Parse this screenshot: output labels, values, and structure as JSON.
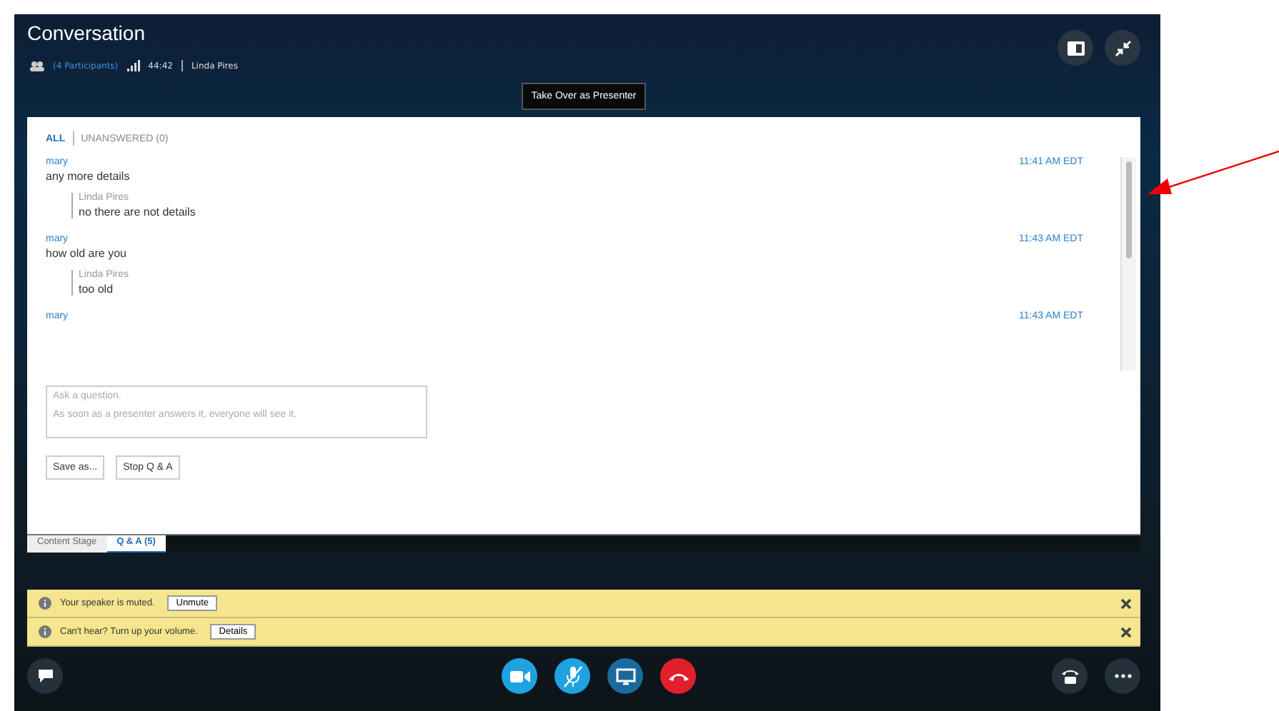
{
  "window": {
    "title": "Conversation"
  },
  "status": {
    "participants": "(4 Participants)",
    "duration": "44:42",
    "presenter": "Linda Pires"
  },
  "presenter_button": "Take Over as Presenter",
  "filters": [
    {
      "label": "ALL",
      "selected": true
    },
    {
      "label": "UNANSWERED (0)",
      "selected": false
    }
  ],
  "questions": [
    {
      "author": "mary",
      "text": "any more details",
      "time": "11:41 AM EDT",
      "answer": {
        "author": "Linda Pires",
        "text": "no there are not details"
      }
    },
    {
      "author": "mary",
      "text": "how old are you",
      "time": "11:43 AM EDT",
      "answer": {
        "author": "Linda Pires",
        "text": "too old"
      }
    },
    {
      "author": "mary",
      "time": "11:43 AM EDT"
    }
  ],
  "question_input": {
    "placeholder": "Ask a question.\nAs soon as a presenter answers it, everyone will see it."
  },
  "buttons": [
    "Save as...",
    "Stop Q & A"
  ],
  "stage_tabs": [
    {
      "label": "Content Stage",
      "selected": false
    },
    {
      "label": "Q & A  (5)",
      "selected": true
    }
  ],
  "notifications": [
    {
      "text": "Your speaker is muted.",
      "action": "Unmute"
    },
    {
      "text": "Can't hear? Turn up your volume.",
      "action": "Details"
    }
  ],
  "call_controls": [
    {
      "kind": "video",
      "color": "#1fa3e0"
    },
    {
      "kind": "mic-muted",
      "color": "#1fa3e0"
    },
    {
      "kind": "screen",
      "color": "#1c6a9c"
    },
    {
      "kind": "hangup",
      "color": "#e2202c"
    }
  ]
}
